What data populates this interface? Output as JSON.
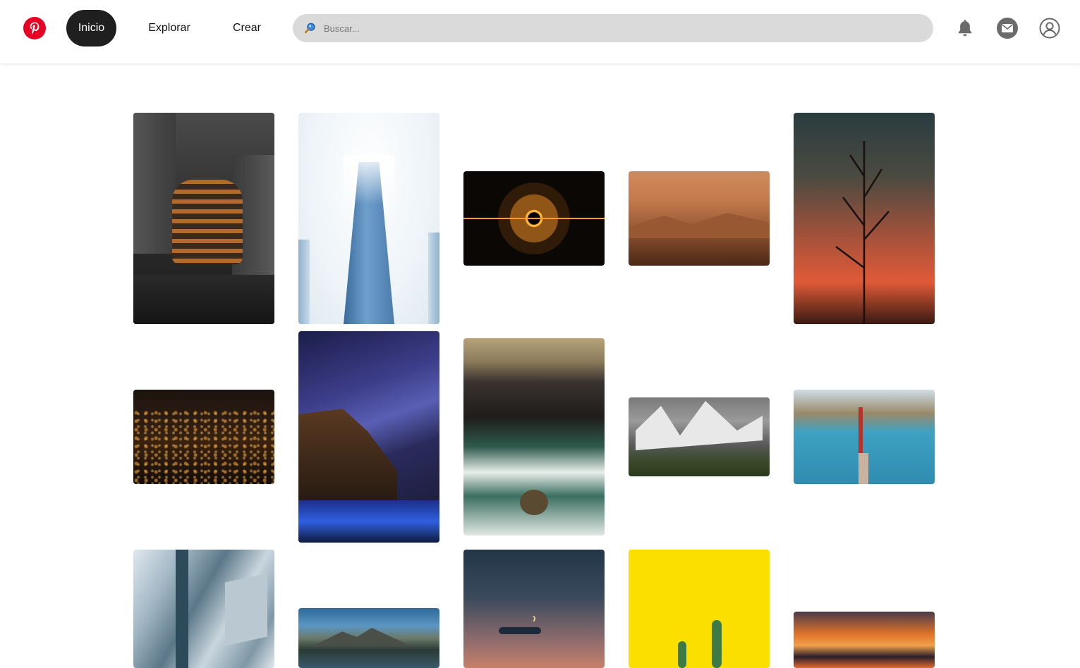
{
  "header": {
    "logo_name": "pinterest-logo",
    "nav": [
      {
        "label": "Inicio",
        "active": true
      },
      {
        "label": "Explorar",
        "active": false
      },
      {
        "label": "Crear",
        "active": false
      }
    ],
    "search": {
      "placeholder": "Buscar...",
      "value": ""
    },
    "icons": [
      "bell-icon",
      "mail-icon",
      "user-icon"
    ]
  },
  "colors": {
    "brand": "#e60023",
    "active_nav": "#1f1f1f",
    "search_bg": "#dadada"
  },
  "pins": [
    {
      "name": "pin-vessel-building"
    },
    {
      "name": "pin-skyscraper-fog"
    },
    {
      "name": "pin-steel-wool-fire"
    },
    {
      "name": "pin-orange-mountains"
    },
    {
      "name": "pin-plant-silhouette-sunset"
    },
    {
      "name": "pin-city-lights-night"
    },
    {
      "name": "pin-milky-way-cliff"
    },
    {
      "name": "pin-aerial-waves"
    },
    {
      "name": "pin-snowy-mountain"
    },
    {
      "name": "pin-golden-gate-bridge"
    },
    {
      "name": "pin-ice-formation"
    },
    {
      "name": "pin-island-landscape"
    },
    {
      "name": "pin-dusk-sky-moon"
    },
    {
      "name": "pin-cactus-yellow"
    },
    {
      "name": "pin-sunset-clouds"
    }
  ]
}
